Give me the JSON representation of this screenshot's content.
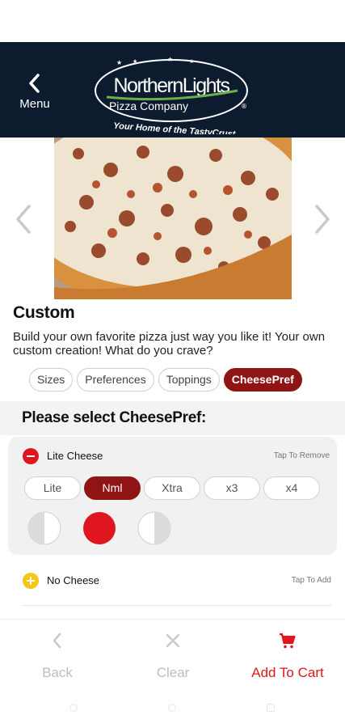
{
  "header": {
    "menu_label": "Menu",
    "logo_line1": "NorthernLights",
    "logo_line2": "Pizza Company",
    "logo_tagline": "Your Home of the TastyCrust"
  },
  "item": {
    "title": "Custom",
    "description": "Build your own favorite pizza just way you like it! Your own custom creation! What do you crave?"
  },
  "tabs": [
    {
      "label": "Sizes",
      "active": false
    },
    {
      "label": "Preferences",
      "active": false
    },
    {
      "label": "Toppings",
      "active": false
    },
    {
      "label": "CheesePref",
      "active": true
    }
  ],
  "section": {
    "heading": "Please select CheesePref:"
  },
  "options": [
    {
      "name": "Lite Cheese",
      "action": "Tap To Remove",
      "icon": "minus-icon",
      "icon_color": "#e0161e",
      "amounts": [
        {
          "label": "Lite",
          "selected": false
        },
        {
          "label": "Nml",
          "selected": true
        },
        {
          "label": "Xtra",
          "selected": false
        },
        {
          "label": "x3",
          "selected": false
        },
        {
          "label": "x4",
          "selected": false
        }
      ],
      "coverage": [
        "left-half",
        "whole",
        "right-half"
      ],
      "selected_coverage": "whole"
    },
    {
      "name": "No Cheese",
      "action": "Tap To Add",
      "icon": "plus-icon",
      "icon_color": "#f5c518"
    }
  ],
  "bottom_bar": {
    "back_label": "Back",
    "clear_label": "Clear",
    "cart_label": "Add To Cart"
  },
  "colors": {
    "header_bg": "#0c1b2e",
    "accent": "#8f1414",
    "cart_red": "#e0161e",
    "disabled": "#bdbdbd"
  }
}
